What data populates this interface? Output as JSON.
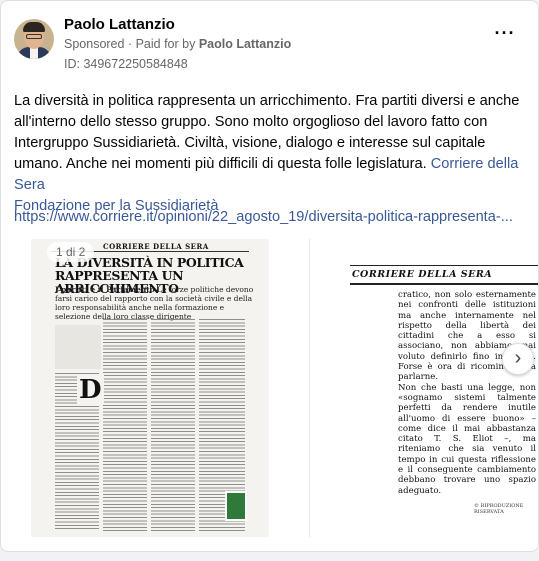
{
  "post": {
    "author": "Paolo Lattanzio",
    "sponsored": "Sponsored",
    "paid_prefix": "Paid for by",
    "paid_by": "Paolo Lattanzio",
    "ad_id": "ID: 349672250584848",
    "more_icon": "more-options-icon",
    "text": "La diversità in politica rappresenta un arricchimento. Fra partiti diversi e anche all'interno dello stesso gruppo. Sono molto orgoglioso del lavoro fatto con Intergruppo Sussidiarietà. Civiltà, visione, dialogo e interesse sul capitale umano. Anche nei momenti più difficili di questa folle legislatura.",
    "tag1": "Corriere della Sera",
    "tag2": "Fondazione per la Sussidiarietà",
    "url": "https://www.corriere.it/opinioni/22_agosto_19/diversita-politica-rappresenta-..."
  },
  "carousel": {
    "counter": "1 di 2",
    "next_icon": "chevron-right-icon",
    "slide1": {
      "masthead": "CORRIERE DELLA SERA",
      "headline": "LA DIVERSITÀ IN POLITICA RAPPRESENTA UN ARRICCHIMENTO",
      "sub_label": "I partiti e il Parlamento",
      "sub_text": "Le forze politiche devono farsi carico del rapporto con la società civile e della loro responsabilità anche nella formazione e selezione della loro classe dirigente"
    },
    "slide2": {
      "masthead": "CORRIERE DELLA SERA",
      "article": "cratico, non solo esternamente nei confronti delle istituzioni ma anche internamente nel rispetto della libertà dei cittadini che a esso si associano, non abbiamo mai voluto definirlo fino in fondo. Forse è ora di ricominciare a parlarne.\n     Non che basti una legge, non «sognamo sistemi talmente perfetti da rendere inutile all'uomo di essere buono» – come dice il mai abbastanza citato T. S. Eliot –, ma riteniamo che sia venuto il tempo in cui questa riflessione e il conseguente cambiamento debbano trovare uno spazio adeguato.",
      "signature": "© RIPRODUZIONE RISERVATA"
    }
  },
  "colors": {
    "link": "#385898",
    "secondary_text": "#65676b",
    "primary_text": "#050505"
  }
}
